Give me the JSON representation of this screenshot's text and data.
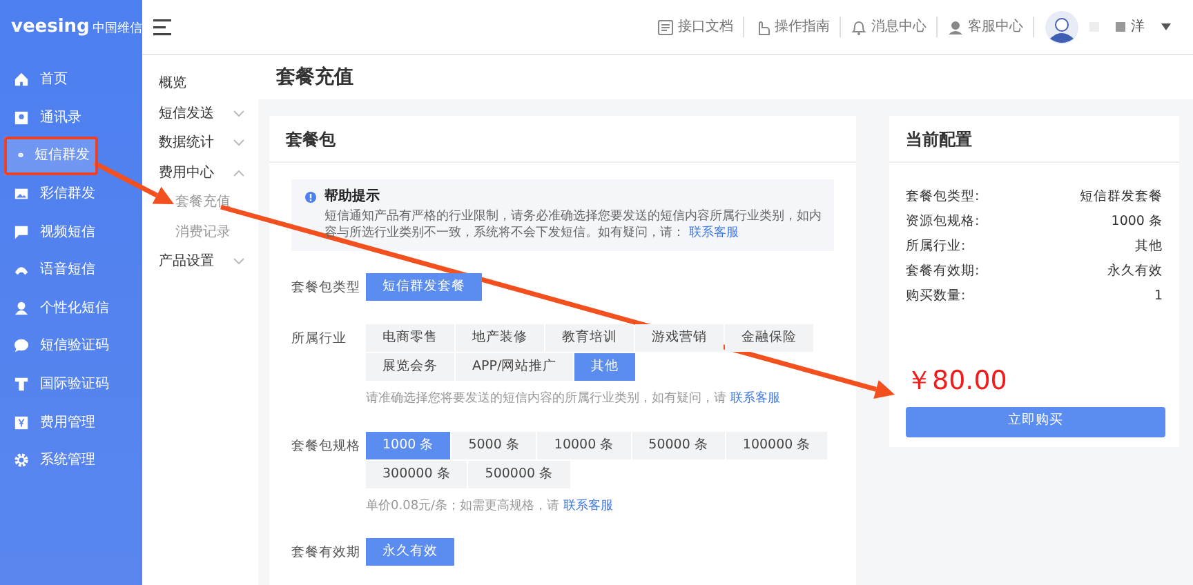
{
  "logo": {
    "brand": "veesing",
    "brand_cn": "中国维信"
  },
  "header": {
    "links": [
      {
        "label": "接口文档"
      },
      {
        "label": "操作指南"
      },
      {
        "label": "消息中心"
      },
      {
        "label": "客服中心"
      }
    ],
    "user": "洋"
  },
  "sidebar": {
    "items": [
      {
        "label": "首页",
        "selected": false,
        "highlighted": false
      },
      {
        "label": "通讯录",
        "selected": false,
        "highlighted": false
      },
      {
        "label": "短信群发",
        "selected": true,
        "highlighted": true
      },
      {
        "label": "彩信群发",
        "selected": false,
        "highlighted": false
      },
      {
        "label": "视频短信",
        "selected": false,
        "highlighted": false
      },
      {
        "label": "语音短信",
        "selected": false,
        "highlighted": false
      },
      {
        "label": "个性化短信",
        "selected": false,
        "highlighted": false
      },
      {
        "label": "短信验证码",
        "selected": false,
        "highlighted": false
      },
      {
        "label": "国际验证码",
        "selected": false,
        "highlighted": false
      },
      {
        "label": "费用管理",
        "selected": false,
        "highlighted": false
      },
      {
        "label": "系统管理",
        "selected": false,
        "highlighted": false
      }
    ]
  },
  "submenu": {
    "items": [
      {
        "label": "概览",
        "kind": "link"
      },
      {
        "label": "短信发送",
        "kind": "group",
        "expanded": false
      },
      {
        "label": "数据统计",
        "kind": "group",
        "expanded": false
      },
      {
        "label": "费用中心",
        "kind": "group",
        "expanded": true,
        "children": [
          {
            "label": "套餐充值"
          },
          {
            "label": "消费记录"
          }
        ]
      },
      {
        "label": "产品设置",
        "kind": "group",
        "expanded": false
      }
    ]
  },
  "page_title": "套餐充值",
  "package_card": {
    "title": "套餐包",
    "help": {
      "title": "帮助提示",
      "text": "短信通知产品有严格的行业限制，请务必准确选择您要发送的短信内容所属行业类别，如内容与所选行业类别不一致，系统将不会下发短信。如有疑问，请：",
      "link": "联系客服"
    },
    "rows": [
      {
        "label": "套餐包类型",
        "options": [
          {
            "label": "短信群发套餐",
            "selected": true
          }
        ]
      },
      {
        "label": "所属行业",
        "options": [
          {
            "label": "电商零售",
            "selected": false
          },
          {
            "label": "地产装修",
            "selected": false
          },
          {
            "label": "教育培训",
            "selected": false
          },
          {
            "label": "游戏营销",
            "selected": false
          },
          {
            "label": "金融保险",
            "selected": false
          },
          {
            "label": "展览会务",
            "selected": false
          },
          {
            "label": "APP/网站推广",
            "selected": false
          },
          {
            "label": "其他",
            "selected": true
          }
        ],
        "note": "请准确选择您将要发送的短信内容的所属行业类别，如有疑问，请",
        "note_link": "联系客服"
      },
      {
        "label": "套餐包规格",
        "options": [
          {
            "label": "1000 条",
            "selected": true
          },
          {
            "label": "5000 条",
            "selected": false
          },
          {
            "label": "10000 条",
            "selected": false
          },
          {
            "label": "50000 条",
            "selected": false
          },
          {
            "label": "100000 条",
            "selected": false
          },
          {
            "label": "300000 条",
            "selected": false
          },
          {
            "label": "500000 条",
            "selected": false
          }
        ],
        "note": "单价0.08元/条；如需更高规格，请",
        "note_link": "联系客服"
      },
      {
        "label": "套餐有效期",
        "options": [
          {
            "label": "永久有效",
            "selected": true
          }
        ]
      }
    ]
  },
  "config_card": {
    "title": "当前配置",
    "items": [
      {
        "label": "套餐包类型:",
        "value": "短信群发套餐"
      },
      {
        "label": "资源包规格:",
        "value": "1000 条"
      },
      {
        "label": "所属行业:",
        "value": "其他"
      },
      {
        "label": "套餐有效期:",
        "value": "永久有效"
      },
      {
        "label": "购买数量:",
        "value": "1"
      }
    ],
    "price": "￥80.00",
    "button": "立即购买"
  },
  "annotations": [
    {
      "kind": "arrow"
    },
    {
      "kind": "arrow"
    }
  ]
}
